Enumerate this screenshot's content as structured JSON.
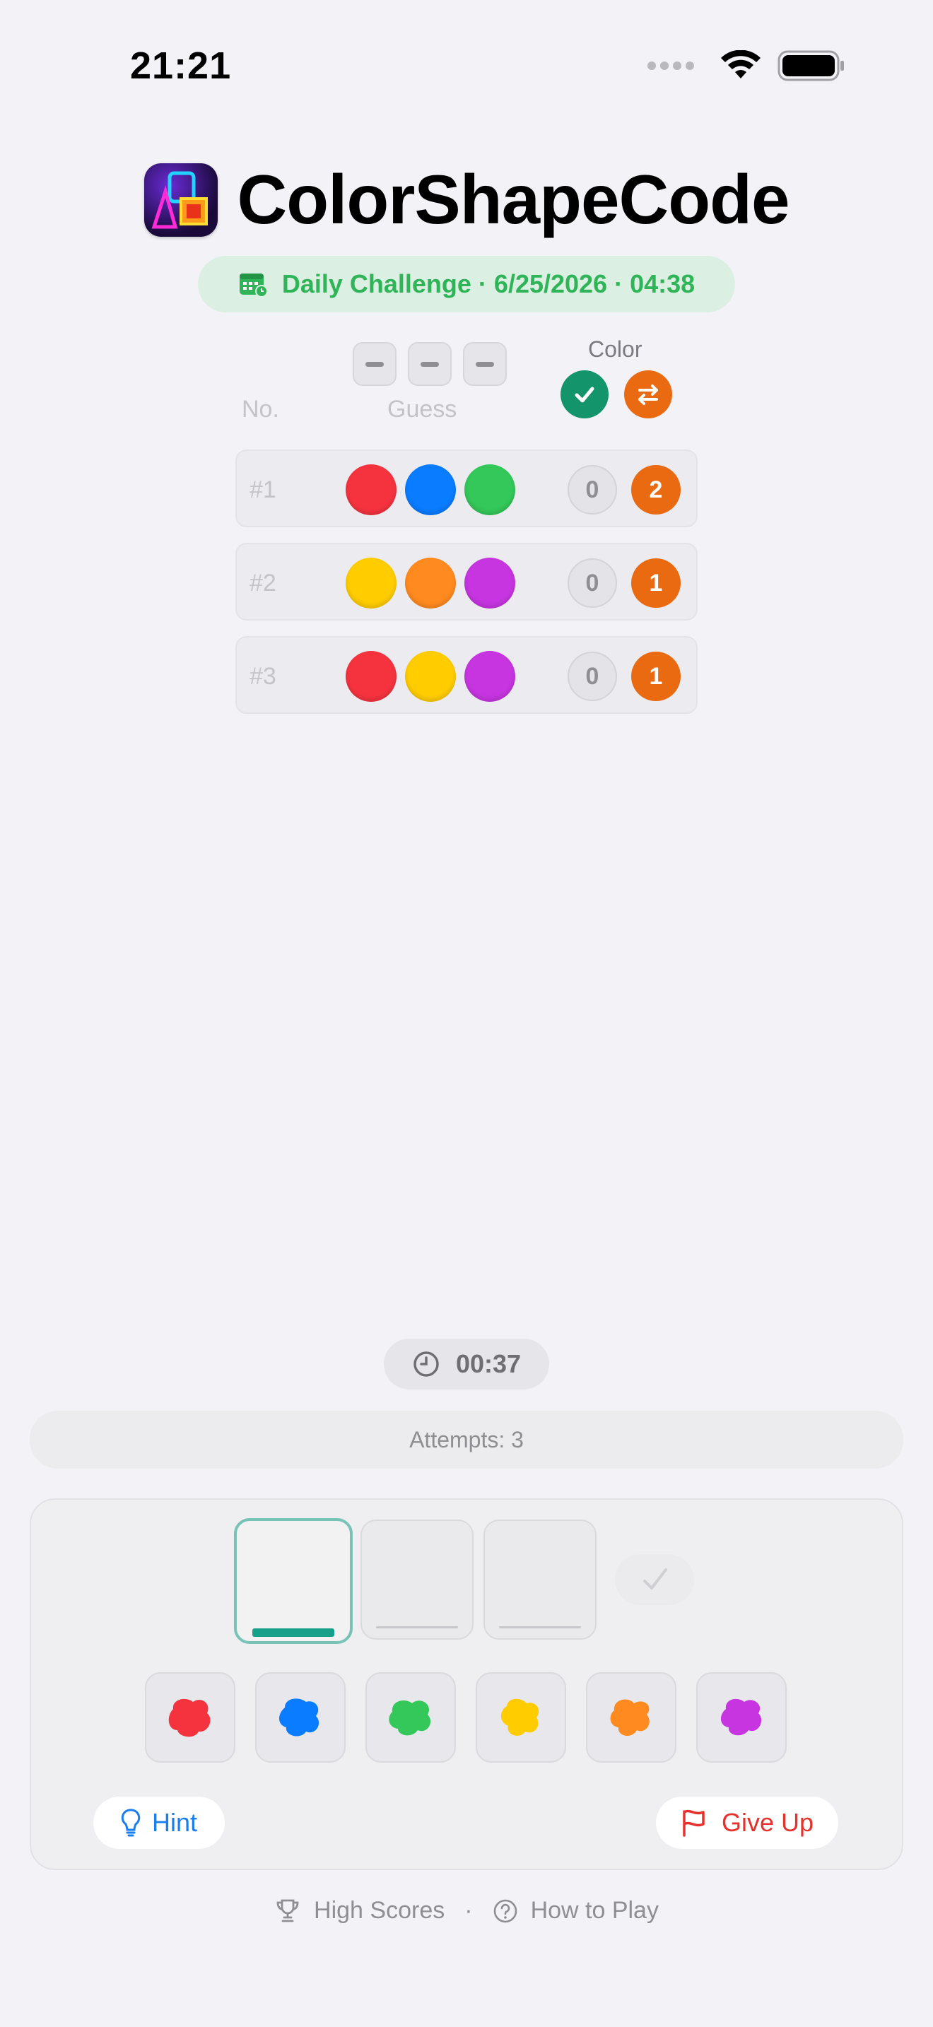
{
  "status_bar": {
    "time": "21:21"
  },
  "app": {
    "title": "ColorShapeCode"
  },
  "daily": {
    "label": "Daily Challenge · 6/25/2026 · 04:38"
  },
  "header": {
    "no": "No.",
    "guess": "Guess",
    "color": "Color"
  },
  "rows": [
    {
      "no": "#1",
      "pegs": [
        "red",
        "blue",
        "green"
      ],
      "correct": "0",
      "misplaced": "2"
    },
    {
      "no": "#2",
      "pegs": [
        "yellow",
        "orange",
        "purple"
      ],
      "correct": "0",
      "misplaced": "1"
    },
    {
      "no": "#3",
      "pegs": [
        "red",
        "yellow",
        "purple"
      ],
      "correct": "0",
      "misplaced": "1"
    }
  ],
  "timer": {
    "value": "00:37"
  },
  "attempts": {
    "label": "Attempts: 3"
  },
  "palette": [
    "red",
    "blue",
    "green",
    "yellow",
    "orange",
    "purple"
  ],
  "actions": {
    "hint": "Hint",
    "give_up": "Give Up"
  },
  "footer": {
    "high_scores": "High Scores",
    "separator": "·",
    "how_to_play": "How to Play"
  },
  "colors": {
    "red": "#f5333f",
    "blue": "#0a7cff",
    "green": "#34c759",
    "yellow": "#ffcc00",
    "orange": "#ff8a1f",
    "purple": "#c635e0",
    "accent_teal": "#16a08a",
    "accent_green": "#2fb457"
  }
}
